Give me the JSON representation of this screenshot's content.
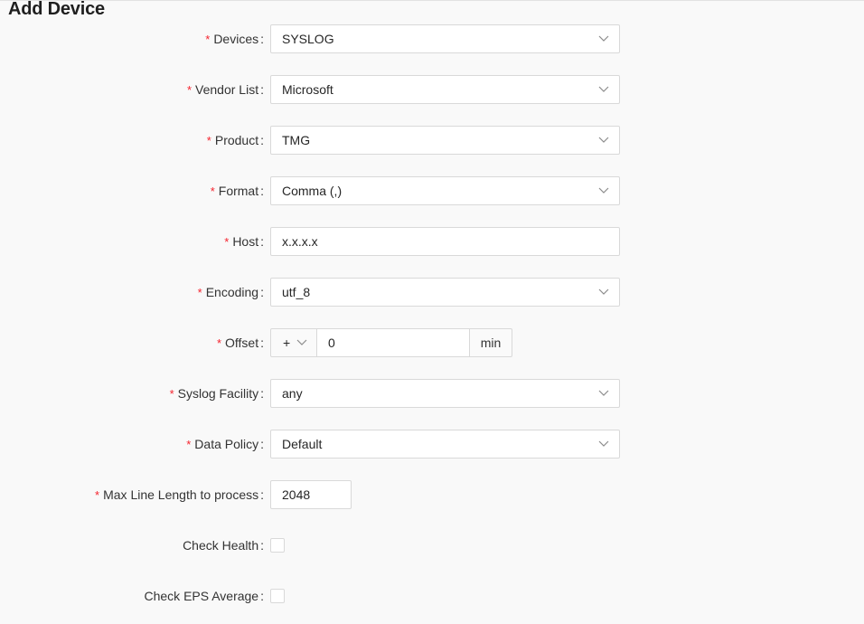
{
  "page": {
    "title": "Add Device"
  },
  "form": {
    "devices": {
      "label": "Devices",
      "value": "SYSLOG"
    },
    "vendor_list": {
      "label": "Vendor List",
      "value": "Microsoft"
    },
    "product": {
      "label": "Product",
      "value": "TMG"
    },
    "format": {
      "label": "Format",
      "value": "Comma (,)"
    },
    "host": {
      "label": "Host",
      "value": "x.x.x.x"
    },
    "encoding": {
      "label": "Encoding",
      "value": "utf_8"
    },
    "offset": {
      "label": "Offset",
      "sign": "+",
      "value": "0",
      "unit": "min"
    },
    "syslog_facility": {
      "label": "Syslog Facility",
      "value": "any"
    },
    "data_policy": {
      "label": "Data Policy",
      "value": "Default"
    },
    "max_line_length": {
      "label": "Max Line Length to process",
      "value": "2048"
    },
    "check_health": {
      "label": "Check Health",
      "checked": false
    },
    "check_eps_average": {
      "label": "Check EPS Average",
      "checked": false
    }
  },
  "icons": {
    "select_arrow": "chevron-down-icon"
  },
  "colors": {
    "required": "#f5222d",
    "border": "#d9d9d9"
  }
}
